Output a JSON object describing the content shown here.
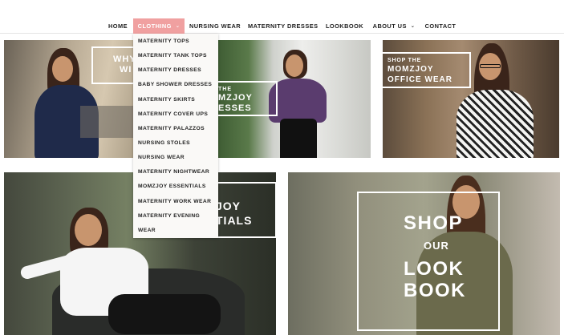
{
  "nav": {
    "items": [
      {
        "label": "HOME"
      },
      {
        "label": "CLOTHING"
      },
      {
        "label": "NURSING WEAR"
      },
      {
        "label": "MATERNITY DRESSES"
      },
      {
        "label": "LOOKBOOK"
      },
      {
        "label": "ABOUT US"
      },
      {
        "label": "CONTACT"
      }
    ],
    "active_color": "#f0a0a0"
  },
  "dropdown": {
    "items": [
      "MATERNITY TOPS",
      "MATERNITY TANK TOPS",
      "MATERNITY DRESSES",
      "BABY SHOWER DRESSES",
      "MATERNITY SKIRTS",
      "MATERNITY COVER UPS",
      "MATERNITY PALAZZOS",
      "NURSING STOLES",
      "NURSING WEAR",
      "MATERNITY NIGHTWEAR",
      "MOMZJOY ESSENTIALS",
      "MATERNITY WORK WEAR",
      "MATERNITY EVENING",
      "WEAR"
    ]
  },
  "banners": {
    "p1": {
      "line1": "WHY",
      "line2": "WI"
    },
    "p2": {
      "line1": "THE",
      "line2": "MZJOY",
      "line3": "ESSES"
    },
    "p3": {
      "line1": "SHOP THE",
      "line2": "MOMZJOY",
      "line3": "OFFICE WEAR"
    },
    "p4": {
      "line1": "JOY",
      "line2": "TIALS"
    },
    "p5": {
      "line1": "SHOP",
      "line2": "OUR",
      "line3": "LOOK",
      "line4": "BOOK"
    }
  }
}
